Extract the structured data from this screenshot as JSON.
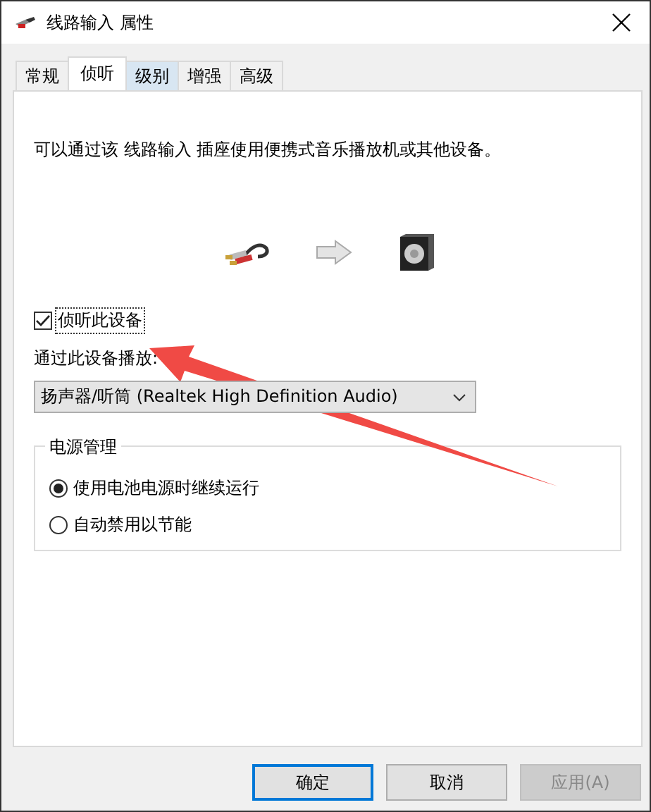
{
  "window": {
    "title": "线路输入 属性"
  },
  "tabs": [
    {
      "label": "常规",
      "selected": false,
      "hovered": false
    },
    {
      "label": "侦听",
      "selected": true,
      "hovered": false
    },
    {
      "label": "级别",
      "selected": false,
      "hovered": true
    },
    {
      "label": "增强",
      "selected": false,
      "hovered": false
    },
    {
      "label": "高级",
      "selected": false,
      "hovered": false
    }
  ],
  "description": "可以通过该 线路输入 插座使用便携式音乐播放机或其他设备。",
  "listen_checkbox": {
    "label": "侦听此设备",
    "checked": true,
    "focused": true
  },
  "playback": {
    "label": "通过此设备播放:",
    "value": "扬声器/听筒 (Realtek High Definition Audio)"
  },
  "power": {
    "title": "电源管理",
    "options": [
      {
        "label": "使用电池电源时继续运行",
        "selected": true
      },
      {
        "label": "自动禁用以节能",
        "selected": false
      }
    ]
  },
  "buttons": [
    {
      "label": "确定",
      "default": true,
      "disabled": false
    },
    {
      "label": "取消",
      "default": false,
      "disabled": false
    },
    {
      "label": "应用(A)",
      "default": false,
      "disabled": true
    }
  ]
}
